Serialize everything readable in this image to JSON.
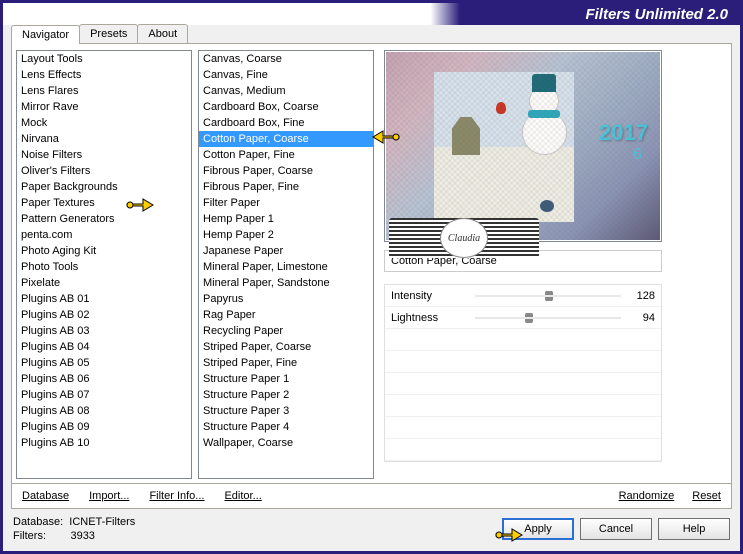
{
  "title": "Filters Unlimited 2.0",
  "tabs": [
    "Navigator",
    "Presets",
    "About"
  ],
  "active_tab": 0,
  "categories": [
    "Layout Tools",
    "Lens Effects",
    "Lens Flares",
    "Mirror Rave",
    "Mock",
    "Nirvana",
    "Noise Filters",
    "Oliver's Filters",
    "Paper Backgrounds",
    "Paper Textures",
    "Pattern Generators",
    "penta.com",
    "Photo Aging Kit",
    "Photo Tools",
    "Pixelate",
    "Plugins AB 01",
    "Plugins AB 02",
    "Plugins AB 03",
    "Plugins AB 04",
    "Plugins AB 05",
    "Plugins AB 06",
    "Plugins AB 07",
    "Plugins AB 08",
    "Plugins AB 09",
    "Plugins AB 10"
  ],
  "category_pointer_index": 9,
  "filters": [
    "Canvas, Coarse",
    "Canvas, Fine",
    "Canvas, Medium",
    "Cardboard Box, Coarse",
    "Cardboard Box, Fine",
    "Cotton Paper, Coarse",
    "Cotton Paper, Fine",
    "Fibrous Paper, Coarse",
    "Fibrous Paper, Fine",
    "Filter Paper",
    "Hemp Paper 1",
    "Hemp Paper 2",
    "Japanese Paper",
    "Mineral Paper, Limestone",
    "Mineral Paper, Sandstone",
    "Papyrus",
    "Rag Paper",
    "Recycling Paper",
    "Striped Paper, Coarse",
    "Striped Paper, Fine",
    "Structure Paper 1",
    "Structure Paper 2",
    "Structure Paper 3",
    "Structure Paper 4",
    "Wallpaper, Coarse"
  ],
  "selected_filter_index": 5,
  "selected_filter_name": "Cotton Paper, Coarse",
  "sliders": {
    "intensity": {
      "label": "Intensity",
      "value": 128
    },
    "lightness": {
      "label": "Lightness",
      "value": 94
    }
  },
  "link_buttons": {
    "database": "Database",
    "import": "Import...",
    "filter_info": "Filter Info...",
    "editor": "Editor...",
    "randomize": "Randomize",
    "reset": "Reset"
  },
  "footer": {
    "db_label": "Database:",
    "db_value": "ICNET-Filters",
    "filters_label": "Filters:",
    "filters_value": "3933",
    "apply": "Apply",
    "cancel": "Cancel",
    "help": "Help"
  },
  "preview": {
    "year": "2017",
    "sub": "6"
  },
  "watermark": "Claudia"
}
